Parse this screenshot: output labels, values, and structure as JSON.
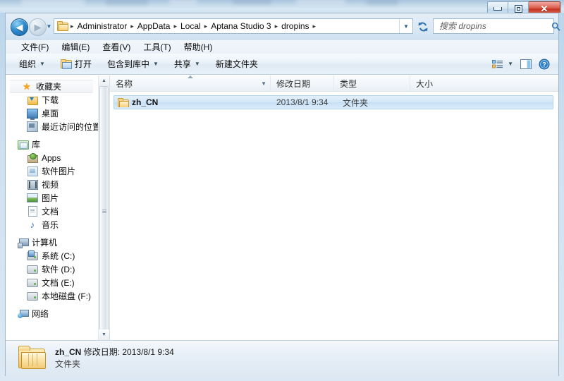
{
  "window": {
    "controls": {
      "minimize": "Minimize",
      "maximize": "Maximize",
      "close": "Close"
    }
  },
  "nav": {
    "back_label": "◀",
    "forward_label": "▶",
    "history_caret": "▼",
    "breadcrumbs": [
      "Administrator",
      "AppData",
      "Local",
      "Aptana Studio 3",
      "dropins"
    ],
    "separator": "▸",
    "address_caret": "▼",
    "refresh_title": "刷新"
  },
  "search": {
    "placeholder": "搜索 dropins",
    "value": ""
  },
  "menubar": {
    "items": [
      "文件(F)",
      "编辑(E)",
      "查看(V)",
      "工具(T)",
      "帮助(H)"
    ]
  },
  "toolbar": {
    "organize": "组织",
    "open": "打开",
    "include_in_library": "包含到库中",
    "share": "共享",
    "new_folder": "新建文件夹",
    "caret": "▼"
  },
  "sidebar": {
    "groups": [
      {
        "header": "收藏夹",
        "header_icon": "star-icon",
        "selected": true,
        "items": [
          {
            "label": "下载",
            "icon": "download-folder-icon"
          },
          {
            "label": "桌面",
            "icon": "desktop-icon"
          },
          {
            "label": "最近访问的位置",
            "icon": "recent-places-icon"
          }
        ]
      },
      {
        "header": "库",
        "header_icon": "library-icon",
        "selected": false,
        "items": [
          {
            "label": "Apps",
            "icon": "apps-library-icon"
          },
          {
            "label": "软件图片",
            "icon": "software-pictures-icon"
          },
          {
            "label": "视频",
            "icon": "videos-icon"
          },
          {
            "label": "图片",
            "icon": "pictures-icon"
          },
          {
            "label": "文档",
            "icon": "documents-icon"
          },
          {
            "label": "音乐",
            "icon": "music-icon"
          }
        ]
      },
      {
        "header": "计算机",
        "header_icon": "computer-icon",
        "selected": false,
        "items": [
          {
            "label": "系统 (C:)",
            "icon": "system-drive-icon"
          },
          {
            "label": "软件 (D:)",
            "icon": "drive-icon"
          },
          {
            "label": "文档 (E:)",
            "icon": "drive-icon"
          },
          {
            "label": "本地磁盘 (F:)",
            "icon": "drive-icon"
          }
        ]
      },
      {
        "header": "网络",
        "header_icon": "network-icon",
        "selected": false,
        "items": []
      }
    ],
    "scroll_up": "▲",
    "scroll_down": "▼"
  },
  "filelist": {
    "columns": [
      {
        "label": "名称",
        "sorted": true
      },
      {
        "label": "修改日期",
        "sorted": false
      },
      {
        "label": "类型",
        "sorted": false
      },
      {
        "label": "大小",
        "sorted": false
      }
    ],
    "rows": [
      {
        "name": "zh_CN",
        "date": "2013/8/1 9:34",
        "type": "文件夹",
        "size": "",
        "selected": true
      }
    ]
  },
  "statusbar": {
    "name": "zh_CN",
    "date_label": "修改日期:",
    "date_value": "2013/8/1 9:34",
    "type": "文件夹"
  },
  "colors": {
    "accent": "#2a7fc4",
    "selection": "#c6dff5",
    "folder": "#f3cb78",
    "close_button": "#c43422"
  }
}
